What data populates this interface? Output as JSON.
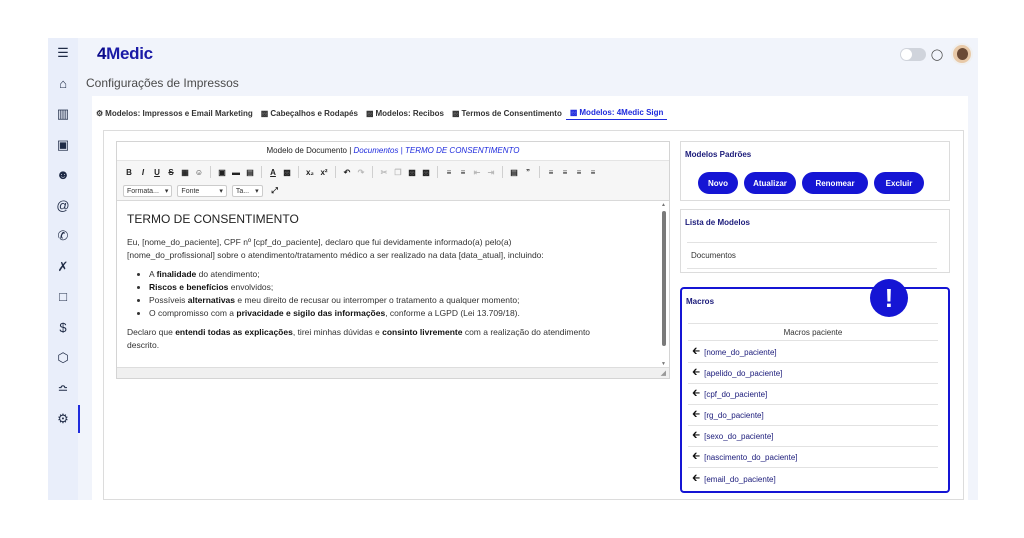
{
  "app": {
    "logo_prefix": "4",
    "logo_rest": "Medic"
  },
  "page": {
    "title": "Configurações de Impressos"
  },
  "tabs": [
    {
      "label": "Modelos: Impressos e Email Marketing"
    },
    {
      "label": "Cabeçalhos e Rodapés"
    },
    {
      "label": "Modelos: Recibos"
    },
    {
      "label": "Termos de Consentimento"
    },
    {
      "label": "Modelos: 4Medic Sign"
    }
  ],
  "editor": {
    "header_prefix": "Modelo de Documento |",
    "header_crumb": "Documentos | TERMO DE CONSENTIMENTO",
    "combo_format": "Formata...",
    "combo_font": "Fonte",
    "combo_size": "Ta...",
    "doc": {
      "title": "TERMO DE CONSENTIMENTO",
      "para1_line1": "Eu, [nome_do_paciente], CPF nº [cpf_do_paciente], declaro que fui devidamente informado(a) pelo(a)",
      "para1_line2": "[nome_do_profissional] sobre o atendimento/tratamento médico a ser realizado na data [data_atual], incluindo:",
      "b1_pre": "A ",
      "b1_bold": "finalidade",
      "b1_post": " do atendimento;",
      "b2_bold": "Riscos e benefícios",
      "b2_post": " envolvidos;",
      "b3_pre": "Possíveis ",
      "b3_bold": "alternativas",
      "b3_post": " e meu direito de recusar ou interromper o tratamento a qualquer momento;",
      "b4_pre": "O compromisso com a ",
      "b4_bold": "privacidade e sigilo das informações",
      "b4_post": ", conforme a LGPD (Lei 13.709/18).",
      "p2_pre": "Declaro que ",
      "p2_b1": "entendi todas as explicações",
      "p2_mid": ", tirei minhas dúvidas e ",
      "p2_b2": "consinto livremente",
      "p2_post": " com a realização do atendimento",
      "p2_line2": "descrito."
    }
  },
  "modelos_padroes": {
    "title": "Modelos Padrões",
    "buttons": {
      "novo": "Novo",
      "atualizar": "Atualizar",
      "renomear": "Renomear",
      "excluir": "Excluir"
    }
  },
  "lista_modelos": {
    "title": "Lista de Modelos",
    "items": [
      "Documentos"
    ]
  },
  "macros": {
    "title": "Macros",
    "subheader": "Macros paciente",
    "items": [
      "[nome_do_paciente]",
      "[apelido_do_paciente]",
      "[cpf_do_paciente]",
      "[rg_do_paciente]",
      "[sexo_do_paciente]",
      "[nascimento_do_paciente]",
      "[email_do_paciente]"
    ],
    "alert_glyph": "!"
  },
  "colors": {
    "accent": "#1515d4",
    "sidebar_bg": "#e9eefa",
    "app_bg": "#f1f4fb"
  }
}
